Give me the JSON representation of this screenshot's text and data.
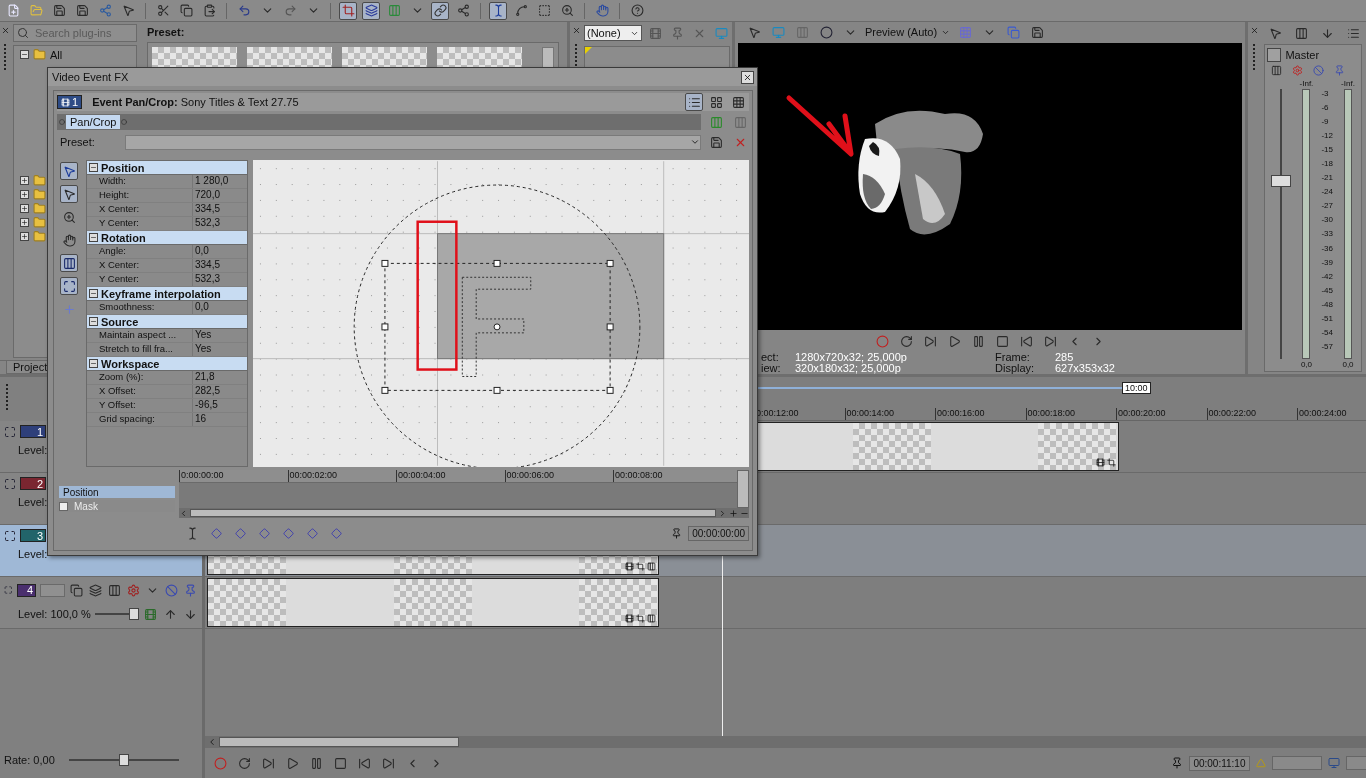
{
  "plugin_pane": {
    "search_placeholder": "Search plug-ins",
    "tree": [
      {
        "label": "All",
        "expanded": true
      },
      {
        "expanded": false
      },
      {
        "expanded": false
      },
      {
        "expanded": false
      },
      {
        "expanded": false
      },
      {
        "expanded": false
      }
    ]
  },
  "preset_pane": {
    "title": "Preset:"
  },
  "left_dock_tabs": [
    {
      "label": "Project",
      "selected": false
    }
  ],
  "trimmer": {
    "dropdown": "(None)"
  },
  "preview": {
    "mode": "Preview (Auto)",
    "stats": [
      {
        "label": "ect:",
        "value": "1280x720x32; 25,000p"
      },
      {
        "label": "iew:",
        "value": "320x180x32; 25,000p"
      },
      {
        "label": "Frame:",
        "value": "285"
      },
      {
        "label": "Display:",
        "value": "627x353x32"
      }
    ]
  },
  "mixer": {
    "title": "Master",
    "peaks": [
      "-Inf.",
      "-Inf."
    ],
    "scale": [
      "-3",
      "-6",
      "-9",
      "-12",
      "-15",
      "-18",
      "-21",
      "-24",
      "-27",
      "-30",
      "-33",
      "-36",
      "-39",
      "-42",
      "-45",
      "-48",
      "-51",
      "-54",
      "-57"
    ],
    "readings": [
      "0,0",
      "0,0"
    ],
    "fader": {
      "level": 0.66
    }
  },
  "timeline": {
    "loop_end": "10:00",
    "ruler": [
      "0:00:12:00",
      "00:00:14:00",
      "00:00:16:00",
      "00:00:18:00",
      "00:00:20:00",
      "00:00:22:00",
      "00:00:24:00"
    ],
    "cursor_time": "00:00:11:10"
  },
  "tracks": [
    {
      "number": "1",
      "color": "#2e3f7a",
      "selected": false,
      "level_label": "Level:"
    },
    {
      "number": "2",
      "color": "#7a2630",
      "selected": false,
      "level_label": "Level:"
    },
    {
      "number": "3",
      "color": "#22646a",
      "selected": true,
      "level_label": "Level:"
    },
    {
      "number": "4",
      "color": "#4a2f6e",
      "selected": false,
      "level_label": "Level: 100,0 %",
      "slider": {
        "level": 0.86
      }
    }
  ],
  "rate": {
    "label": "Rate: 0,00",
    "level": 0.5
  },
  "dialog": {
    "title": "Video Event FX",
    "track_badge": "1",
    "header_label": "Event Pan/Crop:",
    "header_value": "Sony Titles & Text 27.75",
    "chain": [
      {
        "label": "Pan/Crop",
        "selected": true
      }
    ],
    "preset_label": "Preset:",
    "groups": [
      {
        "title": "Position",
        "expanded": true,
        "rows": [
          {
            "label": "Width:",
            "value": "1 280,0"
          },
          {
            "label": "Height:",
            "value": "720,0"
          },
          {
            "label": "X Center:",
            "value": "334,5"
          },
          {
            "label": "Y Center:",
            "value": "532,3"
          }
        ]
      },
      {
        "title": "Rotation",
        "expanded": true,
        "rows": [
          {
            "label": "Angle:",
            "value": "0,0"
          },
          {
            "label": "X Center:",
            "value": "334,5"
          },
          {
            "label": "Y Center:",
            "value": "532,3"
          }
        ]
      },
      {
        "title": "Keyframe interpolation",
        "expanded": true,
        "rows": [
          {
            "label": "Smoothness:",
            "value": "0,0"
          }
        ]
      },
      {
        "title": "Source",
        "expanded": true,
        "rows": [
          {
            "label": "Maintain aspect ...",
            "value": "Yes"
          },
          {
            "label": "Stretch to fill fra...",
            "value": "Yes"
          }
        ]
      },
      {
        "title": "Workspace",
        "expanded": true,
        "rows": [
          {
            "label": "Zoom (%):",
            "value": "21,8"
          },
          {
            "label": "X Offset:",
            "value": "282,5"
          },
          {
            "label": "Y Offset:",
            "value": "-96,5"
          },
          {
            "label": "Grid spacing:",
            "value": "16"
          }
        ]
      }
    ],
    "keyframe_tracks": [
      {
        "label": "Position",
        "selected": true,
        "disabled": false
      },
      {
        "label": "Mask",
        "selected": false,
        "disabled": true,
        "checked": false
      }
    ],
    "keyframe_ruler": [
      "0:00:00:00",
      "00:00:02:00",
      "00:00:04:00",
      "00:00:06:00",
      "00:00:08:00"
    ],
    "time": "00:00:00:00"
  }
}
